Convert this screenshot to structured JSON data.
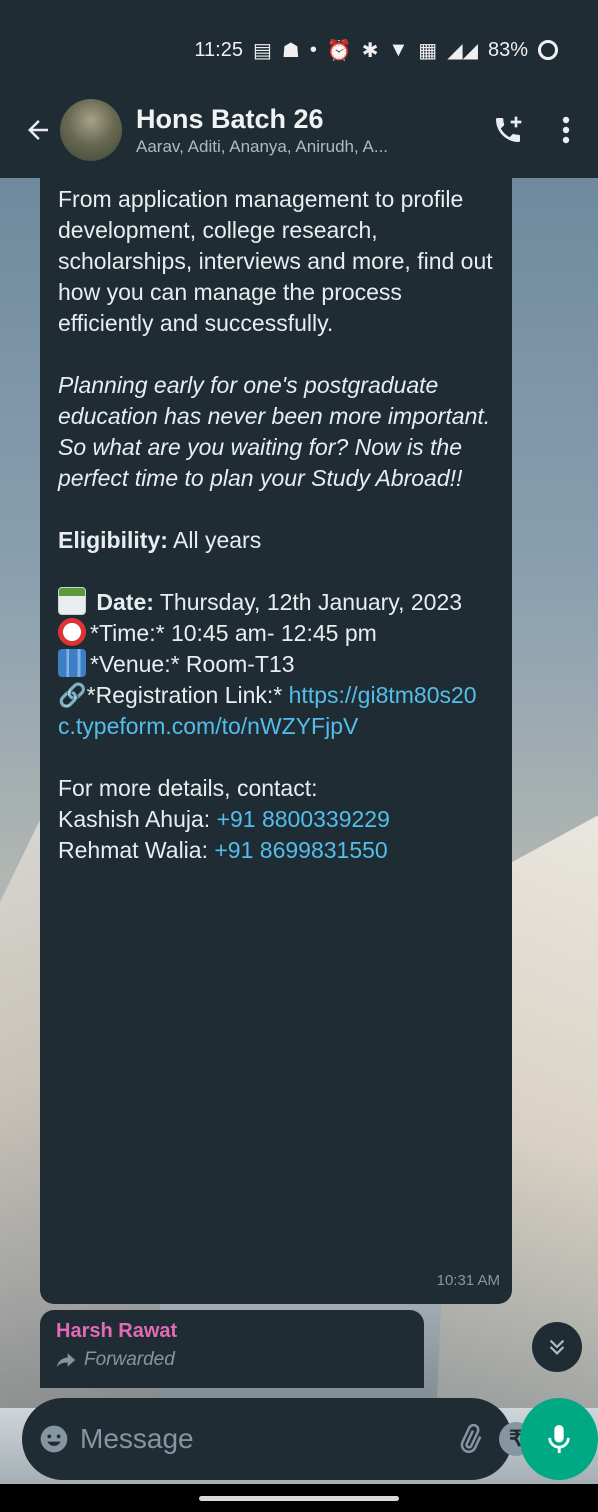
{
  "status_bar": {
    "time": "11:25",
    "dot": "•",
    "battery": "83%"
  },
  "header": {
    "group_name": "Hons Batch 26",
    "members": "Aarav, Aditi, Ananya, Anirudh, A..."
  },
  "message": {
    "para1": "From application management to profile development, college research, scholarships, interviews and more, find out how you can manage the process efficiently and successfully.",
    "para2": "Planning early for one's postgraduate education has never been more important. So what are you waiting for? Now is the perfect time to plan your Study Abroad!!",
    "eligibility_label": "Eligibility:",
    "eligibility_value": " All years",
    "date_label": "Date:",
    "date_value": " Thursday, 12th January, 2023",
    "time_line": "*Time:* 10:45 am- 12:45 pm",
    "venue_line": "*Venue:* Room-T13",
    "registration_label": "*Registration Link:* ",
    "registration_link": "https://gi8tm80s20c.typeform.com/to/nWZYFjpV",
    "contact_heading": "For more details, contact:",
    "contact1_name": "Kashish Ahuja: ",
    "contact1_phone": "+91 8800339229",
    "contact2_name": "Rehmat Walia: ",
    "contact2_phone": "+91 8699831550",
    "timestamp": "10:31 AM"
  },
  "next_message": {
    "sender": "Harsh Rawat",
    "forwarded": "Forwarded"
  },
  "composer": {
    "placeholder": "Message",
    "rupee": "₹"
  },
  "colors": {
    "header_bg": "#1f2c34",
    "bubble_bg": "#1f2c34",
    "link": "#53bdeb",
    "accent": "#00a884",
    "sender_name": "#e26ab6"
  }
}
